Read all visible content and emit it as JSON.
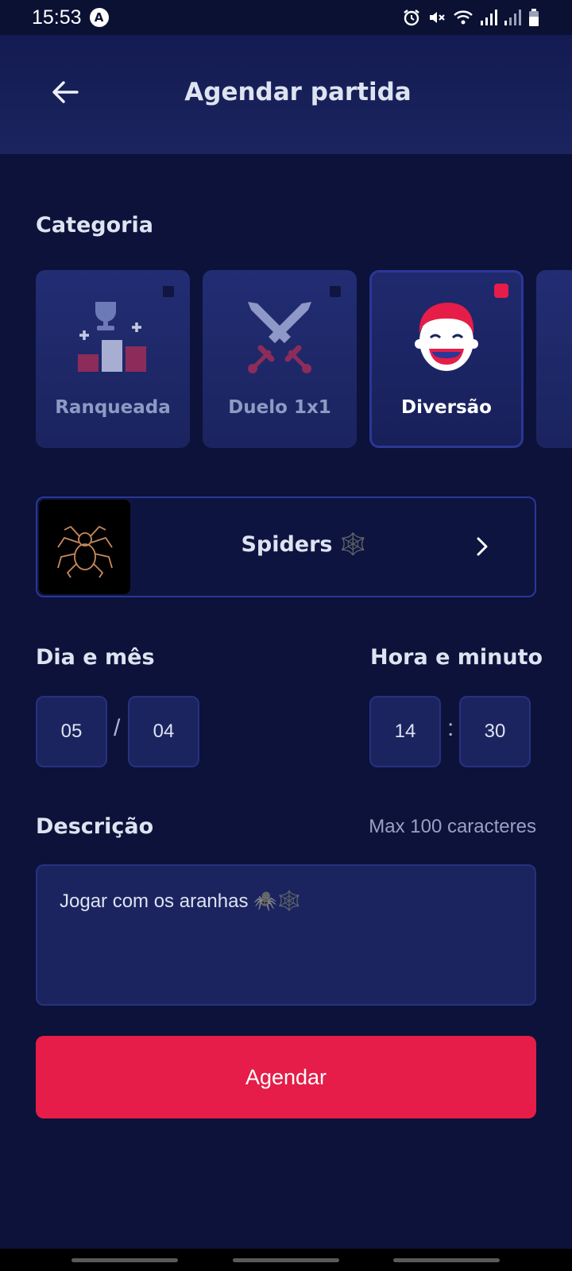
{
  "status_bar": {
    "time": "15:53",
    "notification_icon": "A",
    "icons": [
      "alarm-icon",
      "mute-icon",
      "wifi-icon",
      "signal-icon",
      "signal-icon",
      "battery-icon"
    ]
  },
  "header": {
    "title": "Agendar partida",
    "back_icon": "arrow-left-icon"
  },
  "category": {
    "label": "Categoria",
    "items": [
      {
        "label": "Ranqueada",
        "icon": "podium-trophy-icon",
        "selected": false
      },
      {
        "label": "Duelo 1x1",
        "icon": "crossed-swords-icon",
        "selected": false
      },
      {
        "label": "Diversão",
        "icon": "smiling-face-icon",
        "selected": true
      }
    ]
  },
  "game": {
    "name": "Spiders 🕸️",
    "thumbnail_icon": "spider-icon"
  },
  "date": {
    "label": "Dia e mês",
    "day": "05",
    "month": "04",
    "separator": "/"
  },
  "time": {
    "label": "Hora e minuto",
    "hour": "14",
    "minute": "30",
    "separator": ":"
  },
  "description": {
    "label": "Descrição",
    "hint": "Max 100 caracteres",
    "value": "Jogar com os aranhas 🕷️🕸️"
  },
  "submit": {
    "label": "Agendar"
  },
  "colors": {
    "background": "#0c1239",
    "card": "#1b245f",
    "accent": "#e51d48",
    "border": "#2b3796"
  }
}
